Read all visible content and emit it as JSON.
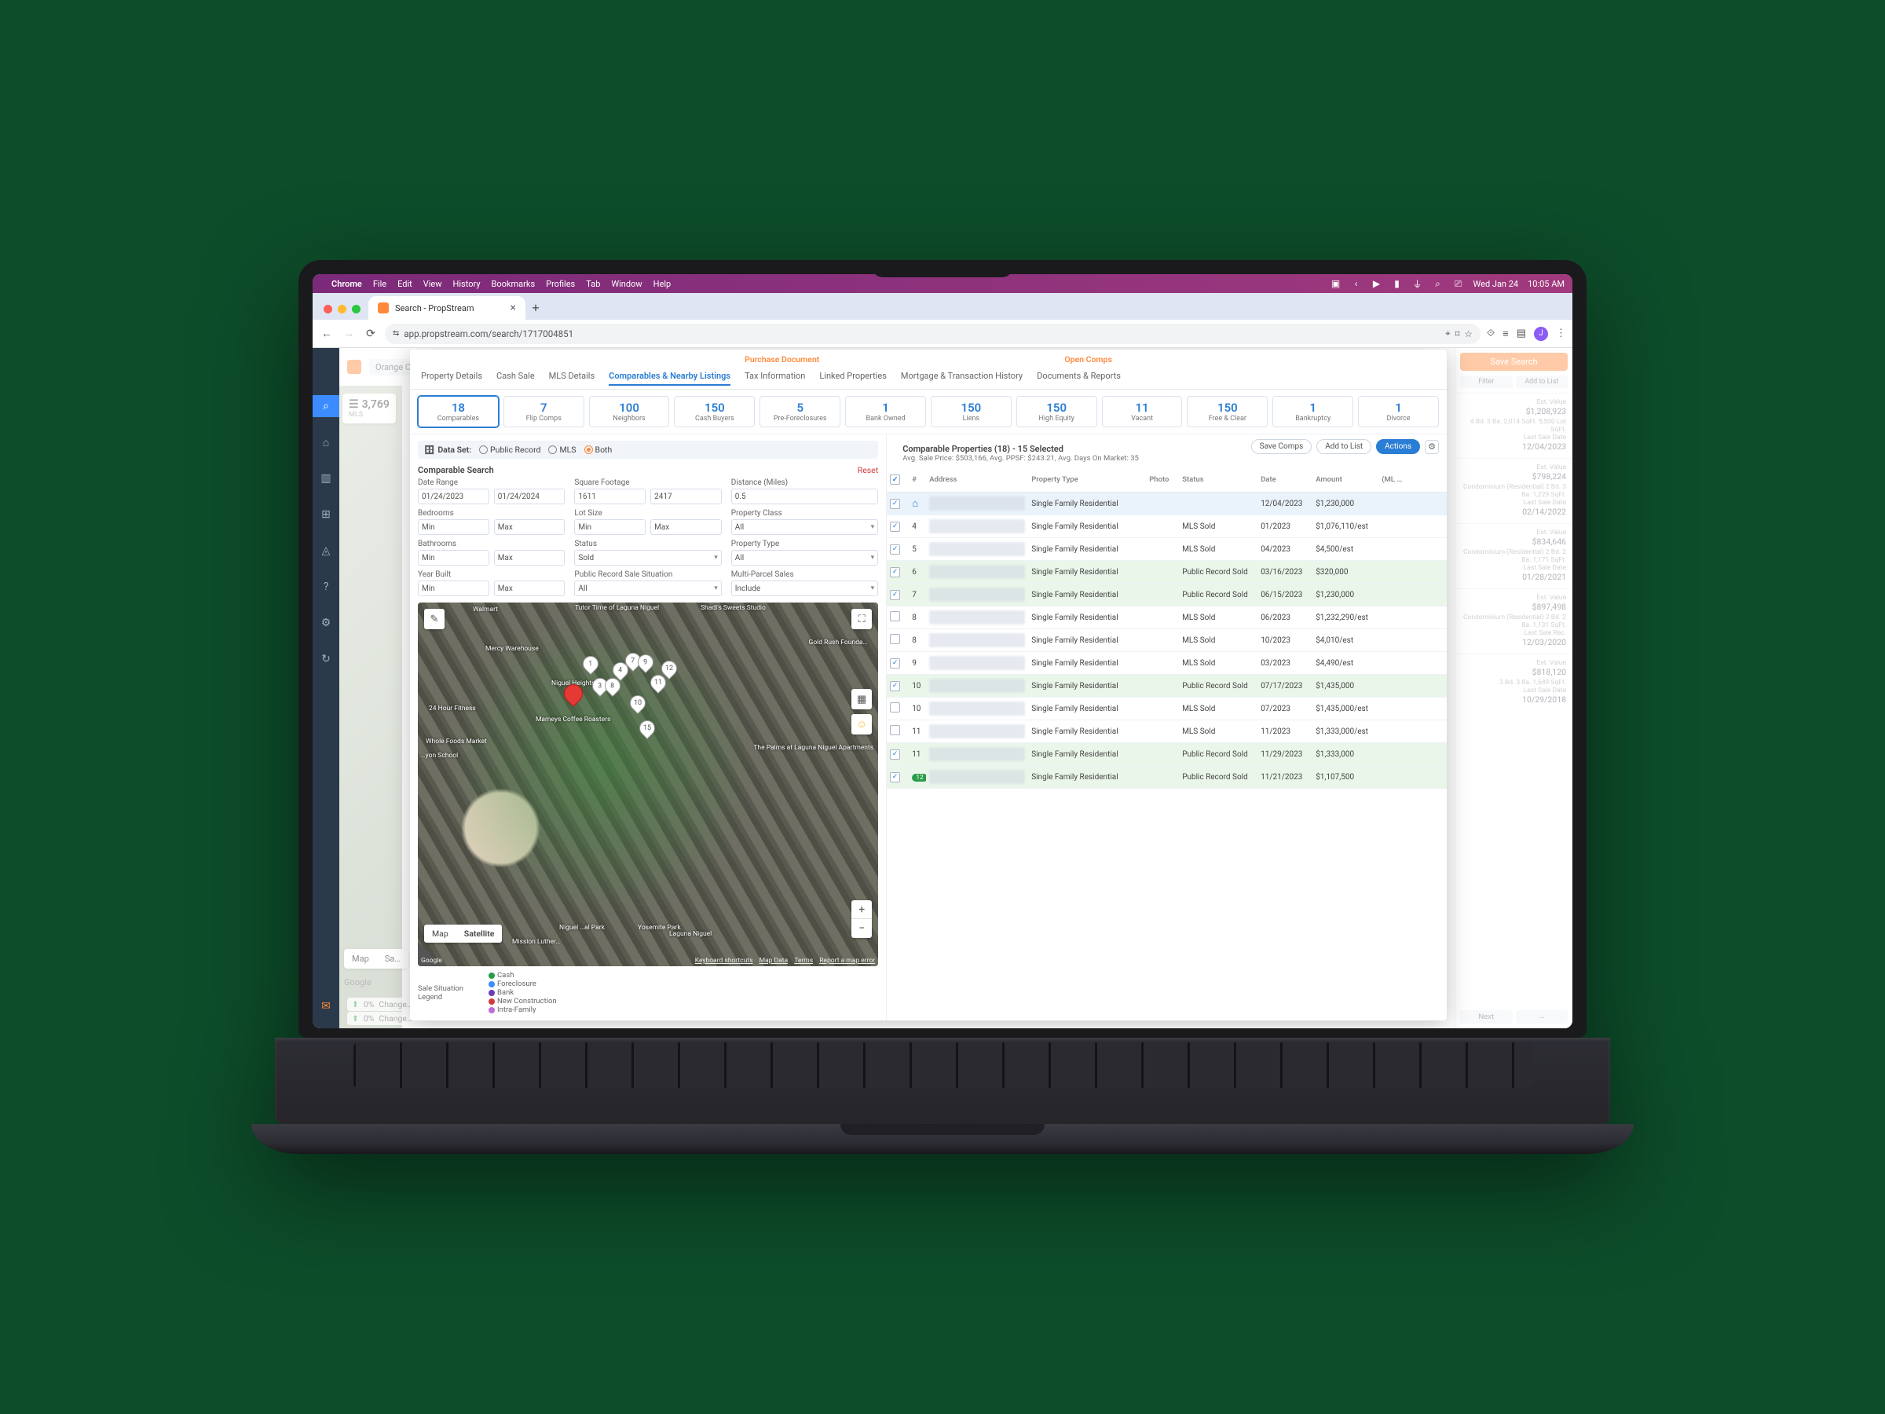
{
  "mac_menu": {
    "app": "Chrome",
    "items": [
      "File",
      "Edit",
      "View",
      "History",
      "Bookmarks",
      "Profiles",
      "Tab",
      "Window",
      "Help"
    ],
    "right": {
      "date": "Wed Jan 24",
      "time": "10:05 AM"
    }
  },
  "browser": {
    "tab_title": "Search - PropStream",
    "url": "app.propstream.com/search/1717004851",
    "avatar_letter": "J"
  },
  "bg": {
    "location_label": "Orange Coun…",
    "mls_count": "3,769",
    "mls_label": "MLS",
    "map_btn": "Map",
    "sat_btn": "Sa…",
    "google": "Google",
    "stat_pct": "0%",
    "stat_text": "Change…"
  },
  "topchips": {
    "left": "Purchase Document",
    "right": "Open Comps"
  },
  "tabs": [
    "Property Details",
    "Cash Sale",
    "MLS Details",
    "Comparables & Nearby Listings",
    "Tax Information",
    "Linked Properties",
    "Mortgage & Transaction History",
    "Documents & Reports"
  ],
  "active_tab_index": 3,
  "stats": [
    {
      "n": "18",
      "l": "Comparables",
      "active": true
    },
    {
      "n": "7",
      "l": "Flip Comps"
    },
    {
      "n": "100",
      "l": "Neighbors"
    },
    {
      "n": "150",
      "l": "Cash Buyers"
    },
    {
      "n": "5",
      "l": "Pre-Foreclosures"
    },
    {
      "n": "1",
      "l": "Bank Owned"
    },
    {
      "n": "150",
      "l": "Liens"
    },
    {
      "n": "150",
      "l": "High Equity"
    },
    {
      "n": "11",
      "l": "Vacant"
    },
    {
      "n": "150",
      "l": "Free & Clear"
    },
    {
      "n": "1",
      "l": "Bankruptcy"
    },
    {
      "n": "1",
      "l": "Divorce"
    }
  ],
  "dataset": {
    "label": "Data Set:",
    "options": [
      "Public Record",
      "MLS",
      "Both"
    ],
    "selected": "Both"
  },
  "search_header": {
    "title": "Comparable Search",
    "reset": "Reset"
  },
  "filters": {
    "date_range": {
      "label": "Date Range",
      "from": "01/24/2023",
      "to": "01/24/2024"
    },
    "sqft": {
      "label": "Square Footage",
      "from": "1611",
      "to": "2417"
    },
    "distance": {
      "label": "Distance (Miles)",
      "val": "0.5"
    },
    "bedrooms": {
      "label": "Bedrooms",
      "min": "Min",
      "max": "Max"
    },
    "lot": {
      "label": "Lot Size",
      "min": "Min",
      "max": "Max"
    },
    "pclass": {
      "label": "Property Class",
      "val": "All"
    },
    "bath": {
      "label": "Bathrooms",
      "min": "Min",
      "max": "Max"
    },
    "status": {
      "label": "Status",
      "val": "Sold"
    },
    "ptype": {
      "label": "Property Type",
      "val": "All"
    },
    "year": {
      "label": "Year Built",
      "min": "Min",
      "max": "Max"
    },
    "prsale": {
      "label": "Public Record Sale Situation",
      "val": "All"
    },
    "multiparcel": {
      "label": "Multi-Parcel Sales",
      "val": "Include"
    }
  },
  "map": {
    "type_map": "Map",
    "type_sat": "Satellite",
    "google": "Google",
    "attr": [
      "Keyboard shortcuts",
      "Map Data",
      "Terms",
      "Report a map error"
    ],
    "labels": [
      "Walmart",
      "Tutor Time of Laguna Niguel",
      "Shadi's Sweets Studio",
      "Mercy Warehouse",
      "Gold Rush Founda…",
      "24 Hour Fitness",
      "Mameys Coffee Roasters",
      "Whole Foods Market",
      "The Palms at Laguna Niguel Apartments",
      "Yosemite Park",
      "Laguna Niguel",
      "Mission Luther…",
      "Niguel Heights Park",
      "Niguel …al Park",
      "…yon School"
    ],
    "pins": [
      "1",
      "3",
      "4",
      "7",
      "8",
      "9",
      "10",
      "11",
      "12",
      "15"
    ]
  },
  "legend": {
    "title": "Sale Situation Legend",
    "items": [
      {
        "c": "#2a9d4a",
        "t": "Cash"
      },
      {
        "c": "#3d8cff",
        "t": "Foreclosure"
      },
      {
        "c": "#6a3db8",
        "t": "Bank"
      },
      {
        "c": "#d43a3a",
        "t": "New Construction"
      },
      {
        "c": "#c06ad4",
        "t": "Intra-Family"
      }
    ]
  },
  "cp": {
    "title": "Comparable Properties (18) - 15 Selected",
    "sub": "Avg. Sale Price: $503,166, Avg. PPSF: $243.21, Avg. Days On Market: 35",
    "btns": {
      "save": "Save Comps",
      "add": "Add to List",
      "actions": "Actions"
    },
    "columns": [
      "",
      "#",
      "Address",
      "Property Type",
      "Photo",
      "Status",
      "Date",
      "Amount",
      "(ML Day Ma…"
    ],
    "rows": [
      {
        "sel": true,
        "n": "",
        "subject": true,
        "type": "Single Family Residential",
        "status": "",
        "date": "12/04/2023",
        "amount": "$1,230,000",
        "cls": "blue"
      },
      {
        "sel": true,
        "n": "4",
        "type": "Single Family Residential",
        "status": "MLS Sold",
        "date": "01/2023",
        "amount": "$1,076,110/est"
      },
      {
        "sel": true,
        "n": "5",
        "type": "Single Family Residential",
        "status": "MLS Sold",
        "date": "04/2023",
        "amount": "$4,500/est"
      },
      {
        "sel": true,
        "n": "6",
        "type": "Single Family Residential",
        "status": "Public Record Sold",
        "date": "03/16/2023",
        "amount": "$320,000",
        "cls": "green"
      },
      {
        "sel": true,
        "n": "7",
        "type": "Single Family Residential",
        "status": "Public Record Sold",
        "date": "06/15/2023",
        "amount": "$1,230,000",
        "cls": "green"
      },
      {
        "sel": false,
        "n": "8",
        "type": "Single Family Residential",
        "status": "MLS Sold",
        "date": "06/2023",
        "amount": "$1,232,290/est"
      },
      {
        "sel": false,
        "n": "8",
        "type": "Single Family Residential",
        "status": "MLS Sold",
        "date": "10/2023",
        "amount": "$4,010/est"
      },
      {
        "sel": true,
        "n": "9",
        "type": "Single Family Residential",
        "status": "MLS Sold",
        "date": "03/2023",
        "amount": "$4,490/est"
      },
      {
        "sel": true,
        "n": "10",
        "type": "Single Family Residential",
        "status": "Public Record Sold",
        "date": "07/17/2023",
        "amount": "$1,435,000",
        "cls": "green"
      },
      {
        "sel": false,
        "n": "10",
        "type": "Single Family Residential",
        "status": "MLS Sold",
        "date": "07/2023",
        "amount": "$1,435,000/est"
      },
      {
        "sel": false,
        "n": "11",
        "type": "Single Family Residential",
        "status": "MLS Sold",
        "date": "11/2023",
        "amount": "$1,333,000/est"
      },
      {
        "sel": true,
        "n": "11",
        "type": "Single Family Residential",
        "status": "Public Record Sold",
        "date": "11/29/2023",
        "amount": "$1,333,000",
        "cls": "green"
      },
      {
        "sel": true,
        "n": "12",
        "badge": true,
        "type": "Single Family Residential",
        "status": "Public Record Sold",
        "date": "11/21/2023",
        "amount": "$1,107,500",
        "cls": "green"
      }
    ]
  },
  "rightcards": {
    "save": "Save Search",
    "filter": "Filter",
    "add": "Add to List",
    "cards": [
      {
        "lab": "Est. Value",
        "val": "$1,208,923",
        "sub": "4 Bd. 3 Ba. 2,014 SqFt. 5,500 Lot SqFt.",
        "lab2": "Last Sale Date",
        "val2": "12/04/2023"
      },
      {
        "lab": "Est. Value",
        "val": "$798,224",
        "sub": "Condominium (Residential) 2 Bd. 3 Ba. 1,229 SqFt.",
        "lab2": "Last Sale Date",
        "val2": "02/14/2022"
      },
      {
        "lab": "Est. Value",
        "val": "$834,646",
        "sub": "Condominium (Residential) 2 Bd. 2 Ba. 1,171 SqFt.",
        "lab2": "Last Sale Date",
        "val2": "01/28/2021"
      },
      {
        "lab": "Est. Value",
        "val": "$897,498",
        "sub": "Condominium (Residential) 2 Bd. 2 Ba. 1,131 SqFt.",
        "lab2": "Last Sale Rec.",
        "val2": "12/03/2020"
      },
      {
        "lab": "Est. Value",
        "val": "$818,120",
        "sub": "3 Bd. 3 Ba. 1,689 SqFt.",
        "lab2": "Last Sale Date",
        "val2": "10/29/2018"
      }
    ],
    "next": "Next"
  }
}
